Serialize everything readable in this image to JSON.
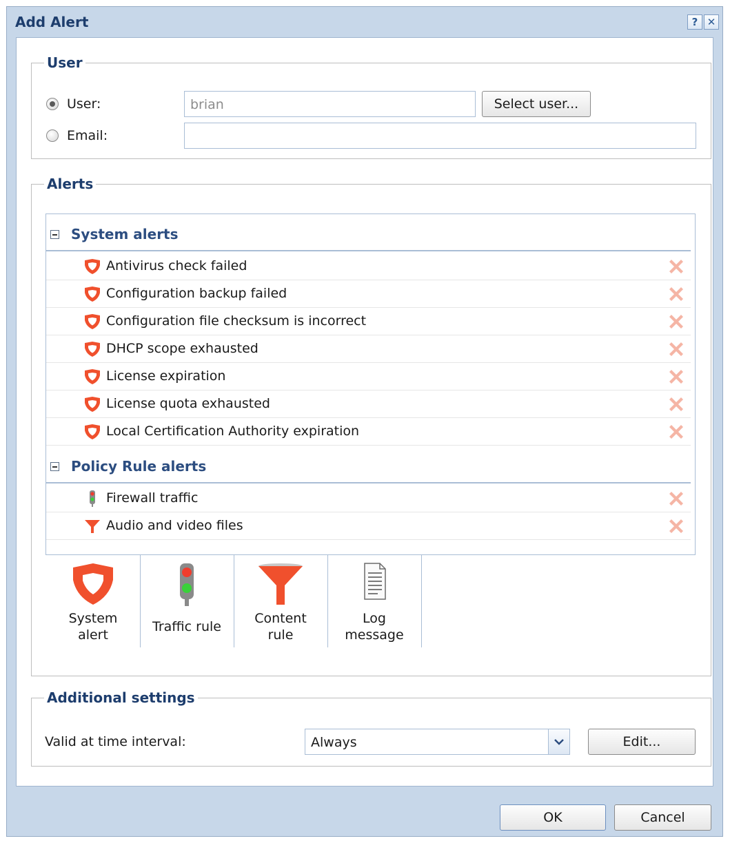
{
  "dialog": {
    "title": "Add Alert",
    "help_icon": "help-icon",
    "close_icon": "close-icon"
  },
  "user_group": {
    "legend": "User",
    "user_radio_label": "User:",
    "user_radio_selected": true,
    "user_value": "brian",
    "select_user_button": "Select user...",
    "email_radio_label": "Email:",
    "email_radio_selected": false,
    "email_value": ""
  },
  "alerts_group": {
    "legend": "Alerts",
    "groups": [
      {
        "title": "System alerts",
        "items": [
          {
            "label": "Antivirus check failed",
            "icon": "shield-icon"
          },
          {
            "label": "Configuration backup failed",
            "icon": "shield-icon"
          },
          {
            "label": "Configuration file checksum is incorrect",
            "icon": "shield-icon"
          },
          {
            "label": "DHCP scope exhausted",
            "icon": "shield-icon"
          },
          {
            "label": "License expiration",
            "icon": "shield-icon"
          },
          {
            "label": "License quota exhausted",
            "icon": "shield-icon"
          },
          {
            "label": "Local Certification Authority expiration",
            "icon": "shield-icon"
          }
        ]
      },
      {
        "title": "Policy Rule alerts",
        "items": [
          {
            "label": "Firewall traffic",
            "icon": "traffic-light-icon"
          },
          {
            "label": "Audio and video files",
            "icon": "funnel-icon"
          }
        ]
      }
    ],
    "palette": [
      {
        "line1": "System",
        "line2": "alert",
        "icon": "shield-icon"
      },
      {
        "line1": "Traffic rule",
        "line2": "",
        "icon": "traffic-light-icon"
      },
      {
        "line1": "Content",
        "line2": "rule",
        "icon": "funnel-icon"
      },
      {
        "line1": "Log",
        "line2": "message",
        "icon": "document-icon"
      }
    ]
  },
  "additional_group": {
    "legend": "Additional settings",
    "time_label": "Valid at time interval:",
    "time_value": "Always",
    "edit_button": "Edit..."
  },
  "footer": {
    "ok_button": "OK",
    "cancel_button": "Cancel"
  },
  "colors": {
    "accent": "#1d3d6d",
    "shield": "#f0502d",
    "delete": "#f5b5a5"
  }
}
